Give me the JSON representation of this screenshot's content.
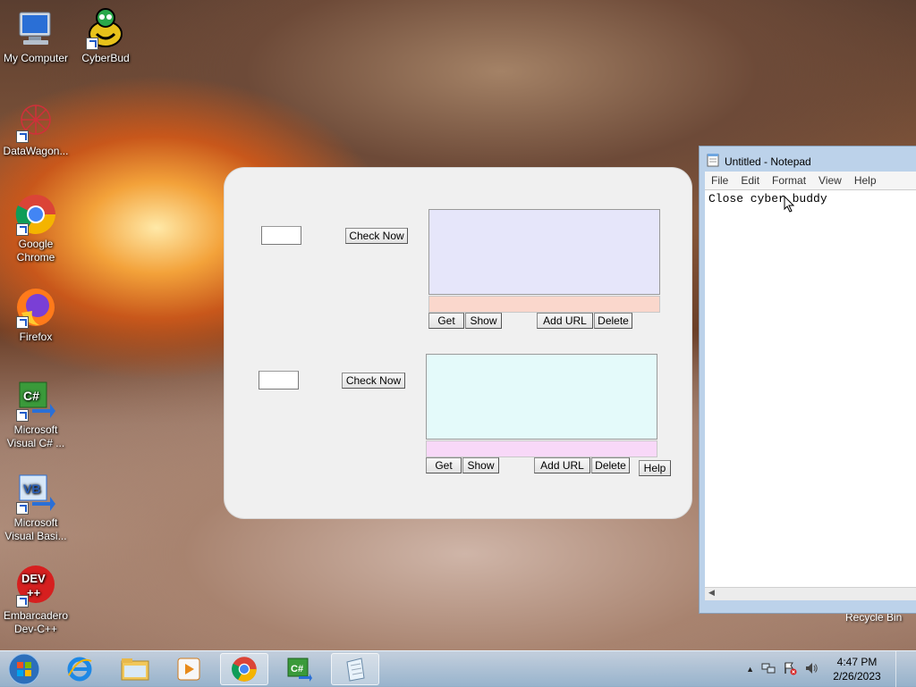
{
  "desktop": {
    "icons": [
      {
        "label": "My Computer"
      },
      {
        "label": "CyberBud"
      },
      {
        "label": "DataWagon..."
      },
      {
        "label": "Google Chrome"
      },
      {
        "label": "Firefox"
      },
      {
        "label": "Microsoft Visual C# ..."
      },
      {
        "label": "Microsoft Visual Basi..."
      },
      {
        "label": "Embarcadero Dev-C++"
      }
    ],
    "recycle_bin": "Recycle Bin"
  },
  "app": {
    "group1": {
      "check_label": "Check Now",
      "get_label": "Get",
      "show_label": "Show",
      "add_url_label": "Add URL",
      "delete_label": "Delete",
      "colors": {
        "panel": "#e6e6fa",
        "strip": "#fad7cc"
      }
    },
    "group2": {
      "check_label": "Check Now",
      "get_label": "Get",
      "show_label": "Show",
      "add_url_label": "Add URL",
      "delete_label": "Delete",
      "colors": {
        "panel": "#e4fafa",
        "strip": "#f8d8f8"
      }
    },
    "help_label": "Help"
  },
  "notepad": {
    "title": "Untitled - Notepad",
    "menu": [
      "File",
      "Edit",
      "Format",
      "View",
      "Help"
    ],
    "content": "Close cyber buddy"
  },
  "taskbar": {
    "time": "4:47 PM",
    "date": "2/26/2023"
  }
}
